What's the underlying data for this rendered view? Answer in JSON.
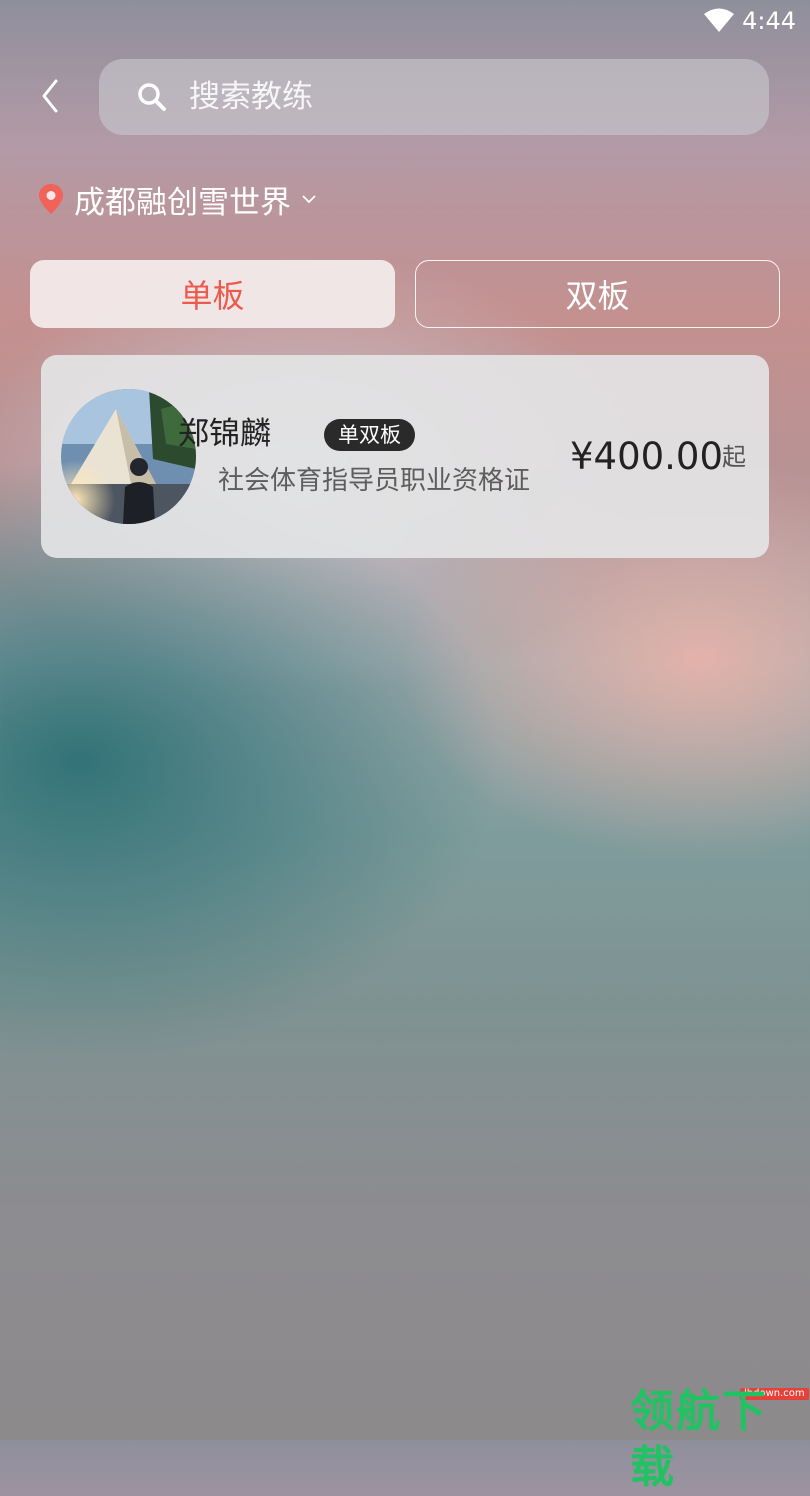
{
  "status_bar": {
    "time": "4:44"
  },
  "search": {
    "placeholder": "搜索教练"
  },
  "location": {
    "name": "成都融创雪世界"
  },
  "tabs": [
    {
      "label": "单板",
      "selected": true
    },
    {
      "label": "双板",
      "selected": false
    }
  ],
  "coach": {
    "name": "郑锦麟",
    "badge": "单双板",
    "certificate": "社会体育指导员职业资格证",
    "price": "¥400.00",
    "price_suffix": "起"
  },
  "watermark": {
    "text": "领航下载",
    "url": "lhdown.com"
  },
  "colors": {
    "accent": "#ec5a4e",
    "badge_bg": "#2a2a2a",
    "pin": "#f0625a"
  },
  "icons": [
    "wifi-icon",
    "back-arrow-icon",
    "search-icon",
    "location-pin-icon",
    "chevron-down-icon"
  ]
}
